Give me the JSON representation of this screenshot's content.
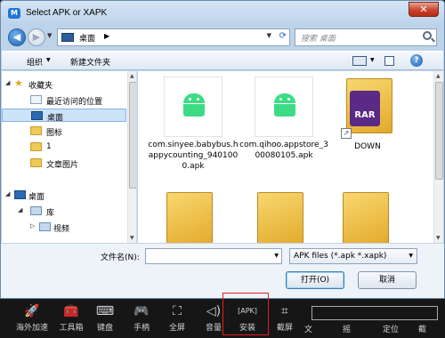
{
  "dialog": {
    "title": "Select APK or XAPK",
    "close_label": "✕",
    "address": {
      "location": "桌面",
      "separator": "▶"
    },
    "search_placeholder": "搜索 桌面",
    "toolbar": {
      "organize": "组织",
      "new_folder": "新建文件夹",
      "help": "?"
    },
    "nav": [
      {
        "label": "收藏夹",
        "icon": "star-icon",
        "expand": "◢"
      },
      {
        "label": "最近访问的位置",
        "icon": "recent-places-icon"
      },
      {
        "label": "桌面",
        "icon": "desktop-icon",
        "selected": true
      },
      {
        "label": "图标",
        "icon": "folder-icon"
      },
      {
        "label": "1",
        "icon": "folder-icon"
      },
      {
        "label": "文章图片",
        "icon": "folder-icon"
      },
      {
        "label": "桌面",
        "icon": "desktop-icon",
        "expand": "◢"
      },
      {
        "label": "库",
        "icon": "library-icon",
        "expand": "◢"
      },
      {
        "label": "视频",
        "icon": "video-library-icon",
        "expand": "▷"
      }
    ],
    "files": [
      {
        "name": "com.sinyee.babybus.happycounting_9401000.apk",
        "icon": "android-apk-icon"
      },
      {
        "name": "com.qihoo.appstore_300080105.apk",
        "icon": "android-apk-icon"
      },
      {
        "name": "DOWN",
        "icon": "winrar-shortcut-icon",
        "badge": "RAR"
      }
    ],
    "filename_label": "文件名(N):",
    "filename_value": "",
    "filetype": "APK files (*.apk *.xapk)",
    "open_button": "打开(O)",
    "cancel_button": "取消"
  },
  "taskbar": {
    "tools": [
      {
        "label": "海外加速",
        "icon": "rocket-icon",
        "glyph": "🚀"
      },
      {
        "label": "工具箱",
        "icon": "toolbox-icon",
        "glyph": "🧰"
      },
      {
        "label": "键盘",
        "icon": "keyboard-icon",
        "glyph": "⌨"
      },
      {
        "label": "手柄",
        "icon": "gamepad-icon",
        "glyph": "🎮"
      },
      {
        "label": "全屏",
        "icon": "fullscreen-icon",
        "glyph": "⛶"
      },
      {
        "label": "音量",
        "icon": "volume-icon",
        "glyph": "◁)"
      },
      {
        "label": "安装",
        "icon": "install-apk-icon",
        "glyph": "[APK]"
      },
      {
        "label": "截屏",
        "icon": "screenshot-icon",
        "glyph": "⌗"
      }
    ],
    "partial_labels": [
      "文",
      "摇",
      "定位",
      "截"
    ]
  }
}
